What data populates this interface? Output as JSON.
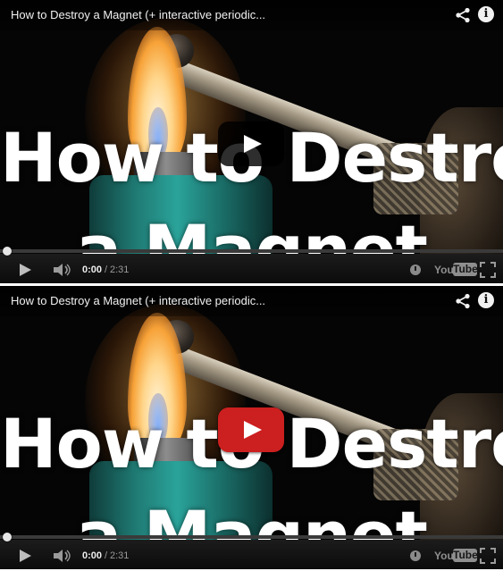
{
  "players": [
    {
      "id": "p1",
      "title": "How to Destroy a Magnet (+ interactive periodic...",
      "headline_line1": "How to Destroy",
      "headline_line2": "a Magnet",
      "info_label": "i",
      "info_side_text": "ᵢ",
      "time_current": "0:00",
      "time_separator": "/",
      "time_duration": "2:31",
      "play_button_style": "dark",
      "progress": 0,
      "youtube_logo": {
        "you": "You",
        "tube": "Tube"
      }
    },
    {
      "id": "p2",
      "title": "How to Destroy a Magnet (+ interactive periodic...",
      "headline_line1": "How to Destroy",
      "headline_line2": "a Magnet",
      "info_label": "i",
      "info_side_text": "ᵢ",
      "time_current": "0:00",
      "time_separator": "/",
      "time_duration": "2:31",
      "play_button_style": "red",
      "progress": 0,
      "youtube_logo": {
        "you": "You",
        "tube": "Tube"
      }
    }
  ],
  "icons": {
    "share": "share-icon",
    "info": "info-icon",
    "play": "play-icon",
    "volume": "volume-icon",
    "watch_later": "clock-icon",
    "fullscreen": "fullscreen-icon"
  },
  "colors": {
    "play_button_red": "#cc1f1f",
    "play_button_dark": "#000000",
    "control_bar": "#111111",
    "title_text": "#f1f1f1"
  }
}
